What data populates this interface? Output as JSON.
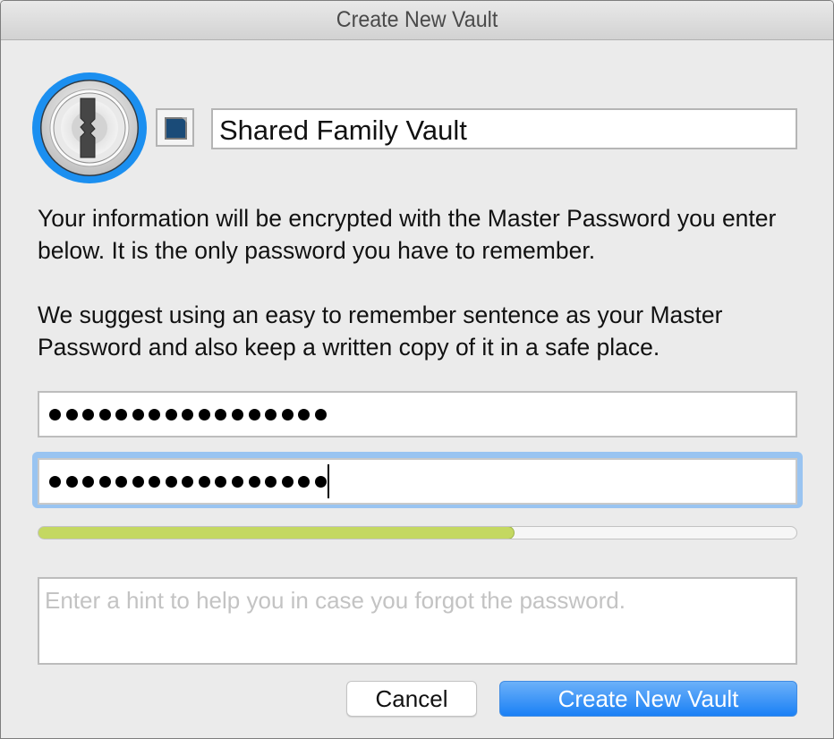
{
  "window": {
    "title": "Create New Vault"
  },
  "vault": {
    "icon": "1password-keyhole-icon",
    "color_swatch": {
      "icon": "color-swatch-icon",
      "color": "#1a4b78"
    },
    "name_value": "Shared Family Vault"
  },
  "description": {
    "paragraph1": "Your information will be encrypted with the Master Password you enter below. It is the only password you have to remember.",
    "paragraph2": "We suggest using an easy to remember sentence as your Master Password and also keep a written copy of it in a safe place."
  },
  "password": {
    "master_masked_length": 17,
    "confirm_masked_length": 17,
    "confirm_focused": true
  },
  "strength_meter": {
    "fraction": 0.628,
    "fill_color": "#c4d861"
  },
  "hint": {
    "value": "",
    "placeholder": "Enter a hint to help you in case you forgot the password."
  },
  "buttons": {
    "cancel_label": "Cancel",
    "create_label": "Create New Vault",
    "primary_color": "#1a80f5"
  },
  "colors": {
    "focus_ring": "#99c4f1",
    "logo_ring": "#1b8ff0"
  }
}
